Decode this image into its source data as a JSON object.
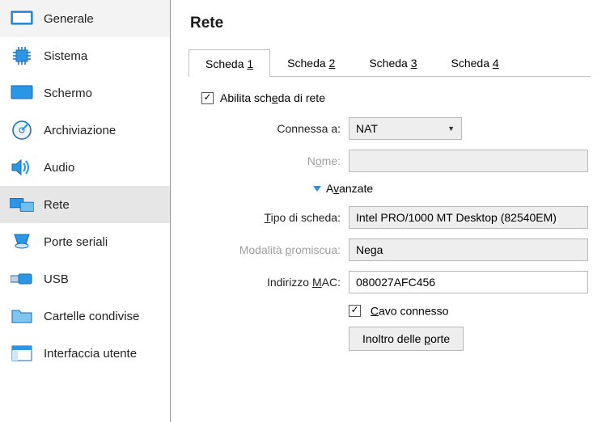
{
  "sidebar": {
    "items": [
      {
        "label": "Generale"
      },
      {
        "label": "Sistema"
      },
      {
        "label": "Schermo"
      },
      {
        "label": "Archiviazione"
      },
      {
        "label": "Audio"
      },
      {
        "label": "Rete"
      },
      {
        "label": "Porte seriali"
      },
      {
        "label": "USB"
      },
      {
        "label": "Cartelle condivise"
      },
      {
        "label": "Interfaccia utente"
      }
    ]
  },
  "page": {
    "title": "Rete"
  },
  "tabs": {
    "t1a": "Scheda ",
    "t1b": "1",
    "t2a": "Scheda ",
    "t2b": "2",
    "t3a": "Scheda ",
    "t3b": "3",
    "t4a": "Scheda ",
    "t4b": "4"
  },
  "form": {
    "enable_a": "Abilita sch",
    "enable_b": "e",
    "enable_c": "da di rete",
    "connected_label": "Connessa a:",
    "connected_value": "NAT",
    "name_a": "N",
    "name_b": "o",
    "name_c": "me:",
    "advanced_a": "A",
    "advanced_b": "v",
    "advanced_c": "anzate",
    "type_a": "T",
    "type_b": "ipo di scheda:",
    "type_value": "Intel PRO/1000 MT Desktop (82540EM)",
    "promisc_a": "Modalità ",
    "promisc_b": "p",
    "promisc_c": "romiscua:",
    "promisc_value": "Nega",
    "mac_a": "Indirizzo ",
    "mac_b": "M",
    "mac_c": "AC:",
    "mac_value": "080027AFC456",
    "cable_a": "C",
    "cable_b": "avo connesso",
    "portfwd_a": "Inoltro delle ",
    "portfwd_b": "p",
    "portfwd_c": "orte"
  }
}
